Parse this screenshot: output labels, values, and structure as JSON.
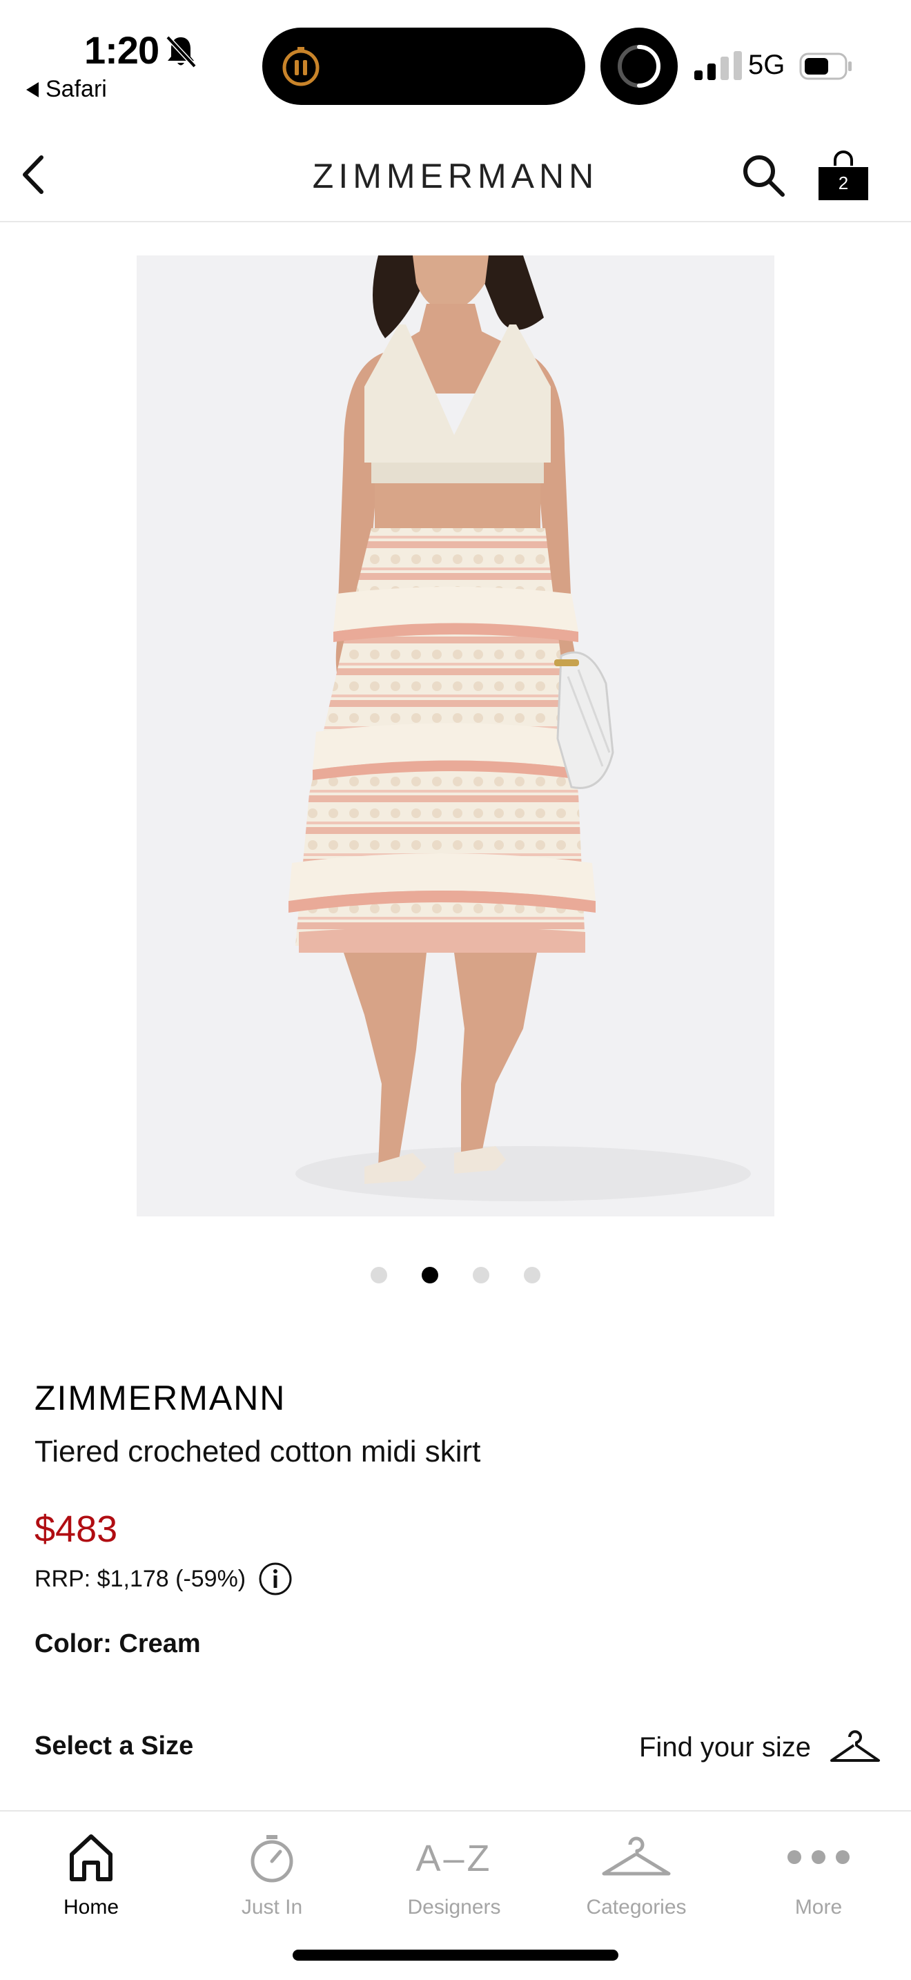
{
  "status_bar": {
    "time": "1:20",
    "back_app": "Safari",
    "network": "5G"
  },
  "header": {
    "brand_logo": "ZIMMERMANN",
    "bag_count": "2",
    "icons": [
      "back-chevron-icon",
      "search-icon",
      "shopping-bag-icon"
    ]
  },
  "gallery": {
    "dots": 4,
    "active_index": 1
  },
  "product": {
    "brand": "ZIMMERMANN",
    "title": "Tiered crocheted cotton midi skirt",
    "price": "$483",
    "rrp": "RRP:  $1,178 (-59%)",
    "color": "Color: Cream",
    "select_size": "Select a Size",
    "find_size": "Find your size"
  },
  "colors": {
    "sale_red": "#b00d12",
    "active_text": "#000000",
    "inactive_text": "#a5a5a5",
    "skirt_pink": "#eab7a6",
    "skirt_cream": "#f4ede0"
  },
  "bottom_nav": {
    "items": [
      {
        "label": "Home",
        "icon": "home-icon"
      },
      {
        "label": "Just In",
        "icon": "stopwatch-icon"
      },
      {
        "label": "Designers",
        "icon": "a-z-icon"
      },
      {
        "label": "Categories",
        "icon": "hanger-icon"
      },
      {
        "label": "More",
        "icon": "more-dots-icon"
      }
    ],
    "active": "Home"
  }
}
